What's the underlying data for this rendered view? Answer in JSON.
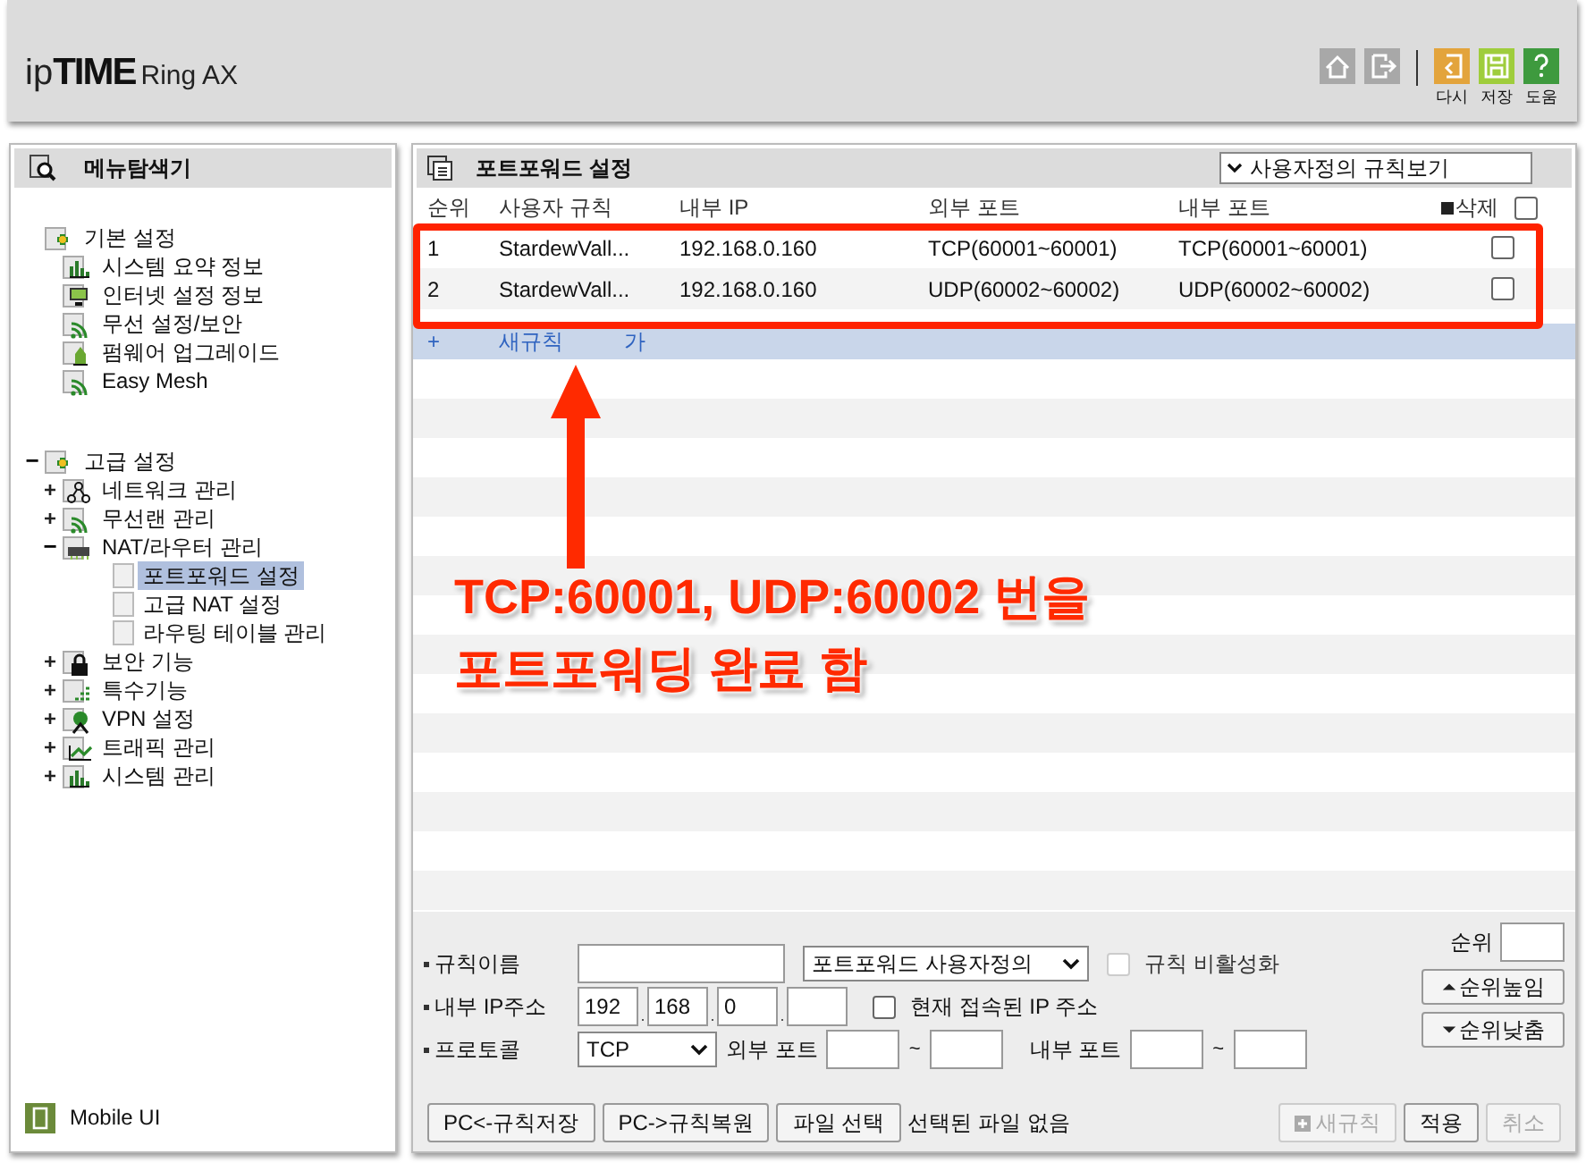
{
  "header": {
    "logo": {
      "prefix": "ip",
      "brand": "TIME",
      "model": "Ring AX"
    },
    "tools": [
      {
        "kind": "home"
      },
      {
        "kind": "logout"
      },
      {
        "kind": "undo",
        "label": "다시"
      },
      {
        "kind": "save",
        "label": "저장"
      },
      {
        "kind": "help",
        "label": "도움"
      }
    ]
  },
  "sidebar": {
    "title": "메뉴탐색기",
    "tree": [
      {
        "label": "기본 설정",
        "kind": "group",
        "children": [
          {
            "label": "시스템 요약 정보",
            "kind": "chart"
          },
          {
            "label": "인터넷 설정 정보",
            "kind": "monitor"
          },
          {
            "label": "무선 설정/보안",
            "kind": "wifi"
          },
          {
            "label": "펌웨어 업그레이드",
            "kind": "upgrade"
          },
          {
            "label": "Easy Mesh",
            "kind": "wifi"
          }
        ]
      },
      {
        "label": "고급 설정",
        "kind": "group",
        "expanded": true,
        "toggle": "−",
        "children": [
          {
            "label": "네트워크 관리",
            "kind": "network",
            "expanded": false,
            "toggle": "+"
          },
          {
            "label": "무선랜 관리",
            "kind": "wifi",
            "expanded": false,
            "toggle": "+"
          },
          {
            "label": "NAT/라우터 관리",
            "kind": "router",
            "expanded": true,
            "toggle": "−",
            "children": [
              {
                "label": "포트포워드 설정",
                "kind": "page",
                "selected": true
              },
              {
                "label": "고급 NAT 설정",
                "kind": "page",
                "selected": false
              },
              {
                "label": "라우팅 테이블 관리",
                "kind": "page",
                "selected": false
              }
            ]
          },
          {
            "label": "보안 기능",
            "kind": "lock",
            "expanded": false,
            "toggle": "+"
          },
          {
            "label": "특수기능",
            "kind": "dots",
            "expanded": false,
            "toggle": "+"
          },
          {
            "label": "VPN 설정",
            "kind": "vpn",
            "expanded": false,
            "toggle": "+"
          },
          {
            "label": "트래픽 관리",
            "kind": "traffic",
            "expanded": false,
            "toggle": "+"
          },
          {
            "label": "시스템 관리",
            "kind": "chart",
            "expanded": false,
            "toggle": "+"
          }
        ]
      }
    ],
    "footer": "Mobile UI"
  },
  "panel": {
    "title": "포트포워드 설정",
    "view_select": "사용자정의 규칙보기",
    "columns": [
      "순위",
      "사용자 규칙",
      "내부 IP",
      "외부 포트",
      "내부 포트",
      "삭제"
    ],
    "select_all_checked": false,
    "rows": [
      {
        "rank": "1",
        "rule": "StardewVall...",
        "ip": "192.168.0.160",
        "external": "TCP(60001~60001)",
        "internal": "TCP(60001~60001)",
        "checked": false
      },
      {
        "rank": "2",
        "rule": "StardewVall...",
        "ip": "192.168.0.160",
        "external": "UDP(60002~60002)",
        "internal": "UDP(60002~60002)",
        "checked": false
      }
    ],
    "add_row": {
      "icon": "+",
      "label_parts": [
        "새규칙",
        "가"
      ]
    },
    "annotation": "TCP:60001, UDP:60002 번을\n포트포워딩 완료 함",
    "form": {
      "rule_name": {
        "label": "규칙이름"
      },
      "rule_type": "포트포워드 사용자정의",
      "disable_rule": {
        "label": "규칙 비활성화",
        "checked": false,
        "disabled": true
      },
      "ip": {
        "label": "내부 IP주소",
        "parts": [
          "192",
          "168",
          "0"
        ]
      },
      "use_current_ip": {
        "label": "현재 접속된 IP 주소",
        "checked": false
      },
      "protocol": {
        "label": "프로토콜",
        "value": "TCP"
      },
      "external_port": {
        "label": "외부 포트"
      },
      "internal_port": {
        "label": "내부 포트"
      },
      "tilde": "~",
      "rank": {
        "label": "순위"
      },
      "rank_up": "순위높임",
      "rank_down": "순위낮춤"
    },
    "buttons": [
      {
        "label": "PC<-규칙저장",
        "disabled": false
      },
      {
        "label": "PC->규칙복원",
        "disabled": false
      },
      {
        "label": "파일 선택",
        "disabled": false
      }
    ],
    "file_status": "선택된 파일 없음",
    "actions": [
      {
        "label": "새규칙",
        "kind": "new",
        "disabled": true
      },
      {
        "label": "적용",
        "kind": "apply",
        "disabled": false
      },
      {
        "label": "취소",
        "kind": "cancel",
        "disabled": true
      }
    ]
  }
}
